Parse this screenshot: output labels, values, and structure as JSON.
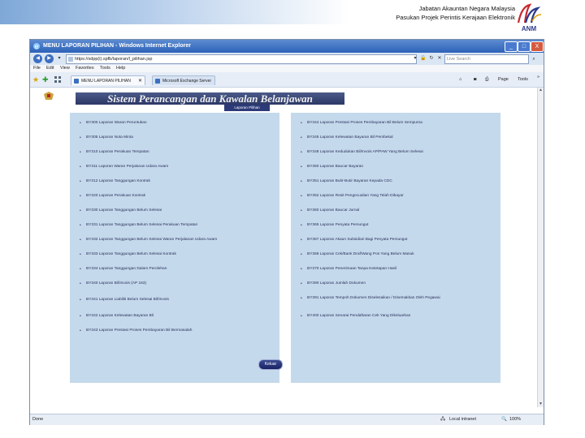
{
  "slide": {
    "org_line1": "Jabatan Akauntan Negara Malaysia",
    "org_line2": "Pasukan Projek Perintis Kerajaan Elektronik",
    "logo_text": "ANM"
  },
  "window": {
    "title": "MENU LAPORAN PILIHAN - Windows Internet Explorer",
    "controls": {
      "minimize": "_",
      "maximize": "□",
      "close": "X"
    }
  },
  "address": {
    "url": "https://sdpp(i).spfb/laporan/l_pilihan.jsp",
    "search_placeholder": "Live Search"
  },
  "menu": [
    "File",
    "Edit",
    "View",
    "Favorites",
    "Tools",
    "Help"
  ],
  "tabs": [
    {
      "label": "MENU LAPORAN PILIHAN"
    },
    {
      "label": "Microsoft Exchange Server"
    }
  ],
  "toolbar_right": {
    "home": "⌂",
    "page": "Page",
    "tools": "Tools"
  },
  "page": {
    "banner_title": "Sistem Perancangan dan Kawalan Belanjawan",
    "banner_subtitle": "Laporan Pilihan",
    "bullet": "•",
    "left_items": [
      "BY300 Laporan Waran Peruntukan",
      "BY305 Laporan Nota Minta",
      "BY310 Laporan Perakuan Tempatan",
      "BY311 Laporan Waran Perjalanan Udara Awam",
      "BY312 Laporan Tanggungan Kontrak",
      "BY320 Laporan Perakuan Kontrak",
      "BY330 Laporan Tanggungan Belum Selesai",
      "BY331 Laporan Tanggungan Belum Selesai Perakuan Tempatan",
      "BY332 Laporan Tanggungan Belum Selesai Waran Perjalanan Udara Awam",
      "BY333 Laporan Tanggungan Belum Selesai Kontrak",
      "BY334 Laporan Tanggungan Dalam Perolehan",
      "BY340 Laporan Bil/Invois (AP 163)",
      "BY341 Laporan Liabiliti Belum Selesai Bil/Invois",
      "BY342 Laporan Kelewatan Bayaran Bil",
      "BY343 Laporan Prestasi Proses Pembayaran Bil Bermasalah"
    ],
    "right_items": [
      "BY344 Laporan Prestasi Proses Pembayaran Bil Belum Sempurna",
      "BY345 Laporan Kelewatan Bayaran Bil Pembekal",
      "BY348 Laporan Kedudukan Bil/Invois AP/PAW Yang Belum Selesai",
      "BY350 Laporan Baucar Bayaran",
      "BY351 Laporan Butir-Butir Bayaran Kepada CDC",
      "BY352 Laporan Resit Pengecualian Yang Telah Dibayar",
      "BY360 Laporan Baucar Jurnal",
      "BY365 Laporan Penyata Pemungut",
      "BY367 Laporan Akaun Subsidiari Bagi Penyata Pemungut",
      "BY368 Laporan Cek/Bank Draf/Wang Pos Yang Belum Masuk",
      "BY370 Laporan Penerimaan Tanpa Ketetapan Hasil",
      "BY390 Laporan Jumlah Dokumen",
      "BY391 Laporan Tempoh Dokumen Diselesaikan / Disemakkan Oleh Pegawai",
      "BY400 Laporan Senarai Pendaftaran Cek Yang Dikeluarkan"
    ],
    "exit_button": "Keluar"
  },
  "status": {
    "left": "Done",
    "zone": "Local intranet",
    "zoom": "100%"
  },
  "colors": {
    "panel": "#c4d9eb",
    "banner": "#2c3866",
    "titlebar": "#2c62b8"
  }
}
